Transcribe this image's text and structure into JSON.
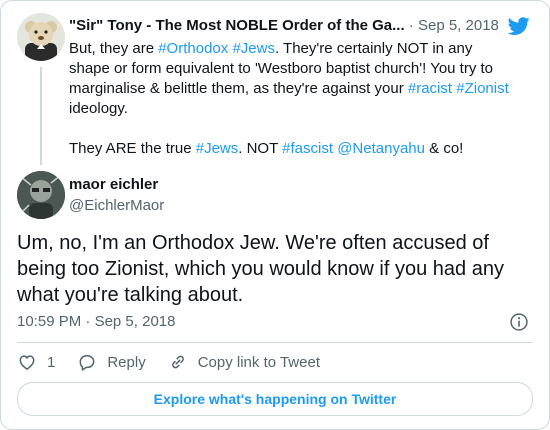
{
  "parent_tweet": {
    "author_name": "\"Sir\" Tony - The Most NOBLE Order of the Ga...",
    "separator": " · ",
    "date": "Sep 5, 2018",
    "paragraph1": [
      {
        "text": "But, they are ",
        "type": "text"
      },
      {
        "text": "#Orthodox",
        "type": "link"
      },
      {
        "text": " ",
        "type": "text"
      },
      {
        "text": "#Jews",
        "type": "link"
      },
      {
        "text": ".  They're certainly NOT in any shape or form equivalent to 'Westboro baptist church'!  You try to marginalise & belittle them, as they're against your ",
        "type": "text"
      },
      {
        "text": "#racist",
        "type": "link"
      },
      {
        "text": " ",
        "type": "text"
      },
      {
        "text": "#Zionist",
        "type": "link"
      },
      {
        "text": " ideology.",
        "type": "text"
      }
    ],
    "paragraph2": [
      {
        "text": "They ARE the true ",
        "type": "text"
      },
      {
        "text": "#Jews",
        "type": "link"
      },
      {
        "text": ". NOT ",
        "type": "text"
      },
      {
        "text": "#fascist",
        "type": "link"
      },
      {
        "text": " ",
        "type": "text"
      },
      {
        "text": "@Netanyahu",
        "type": "link"
      },
      {
        "text": " & co!",
        "type": "text"
      }
    ]
  },
  "tweet": {
    "author_name": "maor eichler",
    "author_handle": "@EichlerMaor",
    "text": "Um, no, I'm an Orthodox Jew. We're often accused of being too Zionist, which you would know if you had any what you're talking about.",
    "time": "10:59 PM",
    "separator": " · ",
    "date": "Sep 5, 2018"
  },
  "actions": {
    "like_count": "1",
    "reply_label": "Reply",
    "copy_link_label": "Copy link to Tweet"
  },
  "explore_label": "Explore what's happening on Twitter",
  "colors": {
    "link": "#1d9bf0",
    "secondary_text": "#536471",
    "border": "#cfd9de"
  },
  "icons": {
    "brand": "twitter-bird-icon",
    "info": "info-icon",
    "like": "heart-icon",
    "reply": "reply-bubble-icon",
    "copy_link": "link-icon"
  }
}
